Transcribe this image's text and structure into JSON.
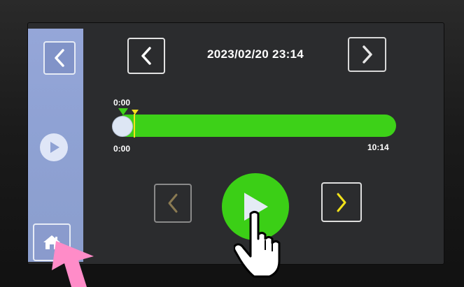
{
  "header": {
    "datetime": "2023/02/20 23:14"
  },
  "timeline": {
    "start_marker_label": "0:00",
    "start_label": "0:00",
    "end_label": "10:14",
    "position_fraction": 0.0
  },
  "colors": {
    "accent_green": "#3dd118",
    "marker_yellow": "#f2e21a",
    "sidebar_blue": "#8fa2d4",
    "screen_bg": "#2b2c2e"
  },
  "icons": {
    "sidebar_back": "chevron-left-icon",
    "sidebar_play": "play-icon",
    "sidebar_home": "home-icon",
    "prev_day": "chevron-left-icon",
    "next_day": "chevron-right-icon",
    "step_back": "chevron-left-icon",
    "step_forward": "chevron-right-icon",
    "main_play": "play-icon"
  }
}
